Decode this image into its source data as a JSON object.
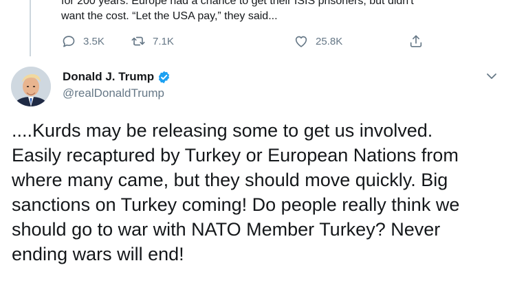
{
  "previous_tweet": {
    "text_line1": "for 200 years. Europe had a chance to get their ISIS prisoners, but didn't",
    "text_line2": "want the cost. “Let the USA pay,” they said...",
    "actions": {
      "reply_count": "3.5K",
      "retweet_count": "7.1K",
      "like_count": "25.8K"
    }
  },
  "tweet": {
    "author": {
      "display_name": "Donald J. Trump",
      "handle": "@realDonaldTrump",
      "verified": true
    },
    "text_lines": [
      "....Kurds may be releasing some to get us involved.",
      "Easily recaptured by Turkey or European Nations from",
      "where many came, but they should move quickly. Big",
      "sanctions on Turkey coming! Do people really think we",
      "should go to war with NATO Member Turkey? Never",
      "ending wars will end!"
    ]
  },
  "icons": {
    "reply": "reply-icon",
    "retweet": "retweet-icon",
    "like": "heart-icon",
    "share": "share-icon",
    "verified": "verified-badge-icon",
    "menu": "chevron-down-icon"
  },
  "colors": {
    "text_primary": "#14171a",
    "text_secondary": "#657786",
    "verified_blue": "#1da1f2",
    "thread_line": "#ccd6dd"
  }
}
